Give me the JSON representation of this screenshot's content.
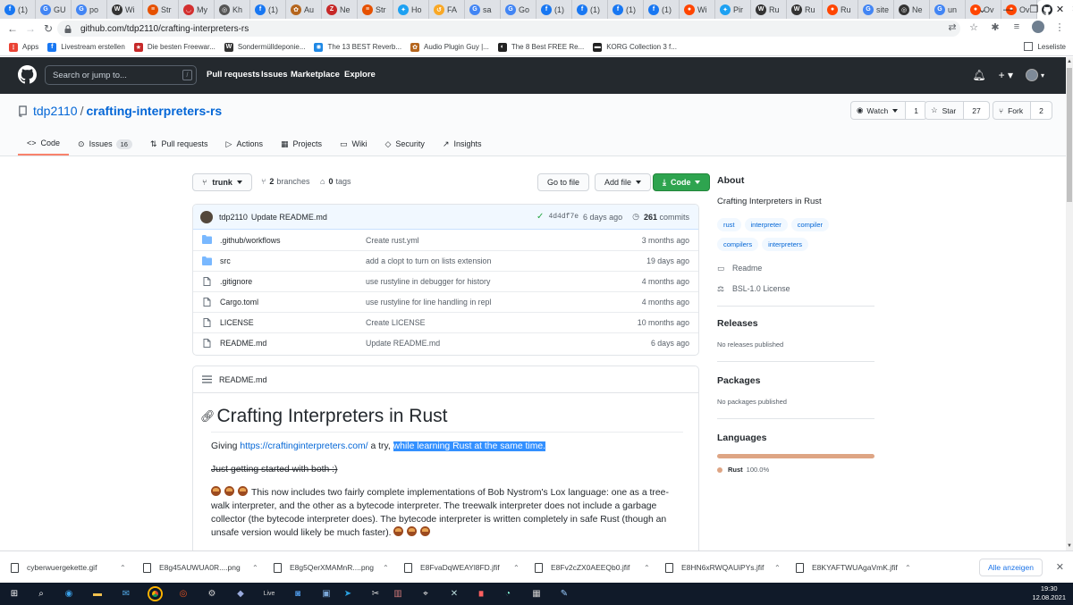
{
  "browser": {
    "tabs": [
      {
        "label": "(1)",
        "color": "#1877f2",
        "g": "f"
      },
      {
        "label": "GU",
        "color": "#4285f4",
        "g": "G"
      },
      {
        "label": "po",
        "color": "#4285f4",
        "g": "G"
      },
      {
        "label": "Wi",
        "color": "#333333",
        "g": "W"
      },
      {
        "label": "Str",
        "color": "#e65100",
        "g": "≡"
      },
      {
        "label": "My",
        "color": "#d32f2f",
        "g": "◡"
      },
      {
        "label": "Kh",
        "color": "#555555",
        "g": "◎"
      },
      {
        "label": "(1)",
        "color": "#1877f2",
        "g": "f"
      },
      {
        "label": "Au",
        "color": "#b5651d",
        "g": "✿"
      },
      {
        "label": "Ne",
        "color": "#c62828",
        "g": "Z"
      },
      {
        "label": "Str",
        "color": "#e65100",
        "g": "≡"
      },
      {
        "label": "Ho",
        "color": "#1da1f2",
        "g": "✦"
      },
      {
        "label": "FA",
        "color": "#f9a825",
        "g": "↺"
      },
      {
        "label": "sa",
        "color": "#4285f4",
        "g": "G"
      },
      {
        "label": "Go",
        "color": "#4285f4",
        "g": "G"
      },
      {
        "label": "(1)",
        "color": "#1877f2",
        "g": "f"
      },
      {
        "label": "(1)",
        "color": "#1877f2",
        "g": "f"
      },
      {
        "label": "(1)",
        "color": "#1877f2",
        "g": "f"
      },
      {
        "label": "(1)",
        "color": "#1877f2",
        "g": "f"
      },
      {
        "label": "Wi",
        "color": "#ff4500",
        "g": "●"
      },
      {
        "label": "Pir",
        "color": "#1da1f2",
        "g": "✦"
      },
      {
        "label": "Ru",
        "color": "#333333",
        "g": "W"
      },
      {
        "label": "Ru",
        "color": "#333333",
        "g": "W"
      },
      {
        "label": "Ru",
        "color": "#ff4500",
        "g": "●"
      },
      {
        "label": "site",
        "color": "#4285f4",
        "g": "G"
      },
      {
        "label": "Ne",
        "color": "#333333",
        "g": "◎"
      },
      {
        "label": "un",
        "color": "#4285f4",
        "g": "G"
      },
      {
        "label": "Ov",
        "color": "#ff4500",
        "g": "●"
      },
      {
        "label": "Ov",
        "color": "#ff4500",
        "g": "●"
      }
    ],
    "active_tab_icon": "github-icon",
    "url": "github.com/tdp2110/crafting-interpreters-rs",
    "bookmarks": [
      {
        "label": "Apps",
        "color": "#ea4335",
        "g": "⋮"
      },
      {
        "label": "Livestream erstellen",
        "color": "#1877f2",
        "g": "f"
      },
      {
        "label": "Die besten Freewar...",
        "color": "#c62828",
        "g": "★"
      },
      {
        "label": "Sondermülldeponie...",
        "color": "#333333",
        "g": "W"
      },
      {
        "label": "The 13 BEST Reverb...",
        "color": "#1e88e5",
        "g": "✺"
      },
      {
        "label": "Audio Plugin Guy |...",
        "color": "#b5651d",
        "g": "✿"
      },
      {
        "label": "The 8 Best FREE Re...",
        "color": "#222222",
        "g": "◐"
      },
      {
        "label": "KORG Collection 3 f...",
        "color": "#222222",
        "g": "▬"
      }
    ],
    "reading_list": "Leseliste"
  },
  "github": {
    "search_placeholder": "Search or jump to...",
    "search_hotkey": "/",
    "nav": [
      "Pull requests",
      "Issues",
      "Marketplace",
      "Explore"
    ],
    "owner": "tdp2110",
    "separator": "/",
    "repo": "crafting-interpreters-rs",
    "watch": {
      "label": "Watch",
      "count": "1"
    },
    "star": {
      "label": "Star",
      "count": "27"
    },
    "fork": {
      "label": "Fork",
      "count": "2"
    },
    "tabs": [
      {
        "label": "Code",
        "badge": ""
      },
      {
        "label": "Issues",
        "badge": "16"
      },
      {
        "label": "Pull requests",
        "badge": ""
      },
      {
        "label": "Actions",
        "badge": ""
      },
      {
        "label": "Projects",
        "badge": ""
      },
      {
        "label": "Wiki",
        "badge": ""
      },
      {
        "label": "Security",
        "badge": ""
      },
      {
        "label": "Insights",
        "badge": ""
      }
    ]
  },
  "repo": {
    "branch": "trunk",
    "branches_count": "2",
    "branches_label": "branches",
    "tags_count": "0",
    "tags_label": "tags",
    "go_to_file": "Go to file",
    "add_file": "Add file",
    "code": "Code",
    "latest_commit": {
      "author": "tdp2110",
      "message": "Update README.md",
      "sha": "4d4df7e",
      "age": "6 days ago",
      "commits_count": "261",
      "commits_label": "commits"
    },
    "files": [
      {
        "type": "folder",
        "name": ".github/workflows",
        "message": "Create rust.yml",
        "age": "3 months ago"
      },
      {
        "type": "folder",
        "name": "src",
        "message": "add a clopt to turn on lists extension",
        "age": "19 days ago"
      },
      {
        "type": "file",
        "name": ".gitignore",
        "message": "use rustyline in debugger for history",
        "age": "4 months ago"
      },
      {
        "type": "file",
        "name": "Cargo.toml",
        "message": "use rustyline for line handling in repl",
        "age": "4 months ago"
      },
      {
        "type": "file",
        "name": "LICENSE",
        "message": "Create LICENSE",
        "age": "10 months ago"
      },
      {
        "type": "file",
        "name": "README.md",
        "message": "Update README.md",
        "age": "6 days ago"
      }
    ],
    "readme": {
      "filename": "README.md",
      "title": "Crafting Interpreters in Rust",
      "p1_prefix": "Giving",
      "p1_link": "https://craftinginterpreters.com/",
      "p1_mid": "a try,",
      "p1_highlight": "while learning Rust at the same time.",
      "p2": "Just getting started with both :)",
      "p3": "This now includes two fairly complete implementations of Bob Nystrom's Lox language: one as a tree-walk interpreter, and the other as a bytecode interpreter. The treewalk interpreter does not include a garbage collector (the bytecode interpreter does). The bytecode interpreter is written completely in safe Rust (though an unsafe version would likely be much faster)."
    }
  },
  "about": {
    "heading": "About",
    "description": "Crafting Interpreters in Rust",
    "topics": [
      "rust",
      "interpreter",
      "compiler",
      "compilers",
      "interpreters"
    ],
    "readme": "Readme",
    "license": "BSL-1.0 License",
    "releases_heading": "Releases",
    "releases_text": "No releases published",
    "packages_heading": "Packages",
    "packages_text": "No packages published",
    "languages_heading": "Languages",
    "language": {
      "name": "Rust",
      "percent": "100.0%",
      "color": "#dea584"
    }
  },
  "downloads": {
    "items": [
      "cyberwuergekette.gif",
      "E8g45AUWUA0R....png",
      "E8g5QerXMAMnR....png",
      "E8FvaDqWEAYl8FD.jfif",
      "E8Fv2cZX0AEEQb0.jfif",
      "E8HN6xRWQAUiPYs.jfif",
      "E8KYAFTWUAgaVmK.jfif"
    ],
    "show_all": "Alle anzeigen"
  },
  "taskbar": {
    "time": "19:30",
    "date": "12.08.2021"
  }
}
